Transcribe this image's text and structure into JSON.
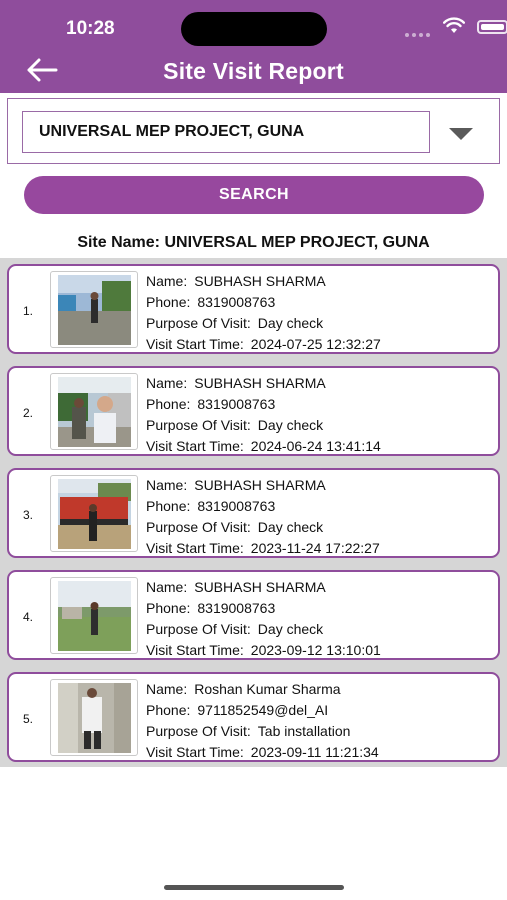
{
  "status_bar": {
    "time": "10:28"
  },
  "header": {
    "title": "Site Visit Report"
  },
  "filter": {
    "selected_site": "UNIVERSAL MEP PROJECT, GUNA"
  },
  "search": {
    "label": "SEARCH"
  },
  "site_name_line": "Site Name: UNIVERSAL MEP PROJECT, GUNA",
  "labels": {
    "name": "Name:",
    "phone": "Phone:",
    "purpose": "Purpose Of Visit:",
    "start_time": "Visit Start Time:"
  },
  "visits": [
    {
      "index": "1.",
      "name": "SUBHASH SHARMA",
      "phone": "8319008763",
      "purpose": "Day check",
      "start_time": "2024-07-25 12:32:27"
    },
    {
      "index": "2.",
      "name": "SUBHASH SHARMA",
      "phone": "8319008763",
      "purpose": "Day check",
      "start_time": "2024-06-24 13:41:14"
    },
    {
      "index": "3.",
      "name": "SUBHASH SHARMA",
      "phone": "8319008763",
      "purpose": "Day check",
      "start_time": "2023-11-24 17:22:27"
    },
    {
      "index": "4.",
      "name": "SUBHASH SHARMA",
      "phone": "8319008763",
      "purpose": "Day check",
      "start_time": "2023-09-12 13:10:01"
    },
    {
      "index": "5.",
      "name": "Roshan Kumar Sharma",
      "phone": "9711852549@del_AI",
      "purpose": "Tab installation",
      "start_time": "2023-09-11 11:21:34"
    }
  ],
  "icons": {
    "back": "arrow-left-icon",
    "dropdown": "caret-down-icon",
    "wifi": "wifi-icon",
    "battery": "battery-icon"
  },
  "colors": {
    "header": "#8f4d9c",
    "button": "#97489e",
    "card_border": "#8f4d9c",
    "list_background": "#d6d6d6"
  }
}
